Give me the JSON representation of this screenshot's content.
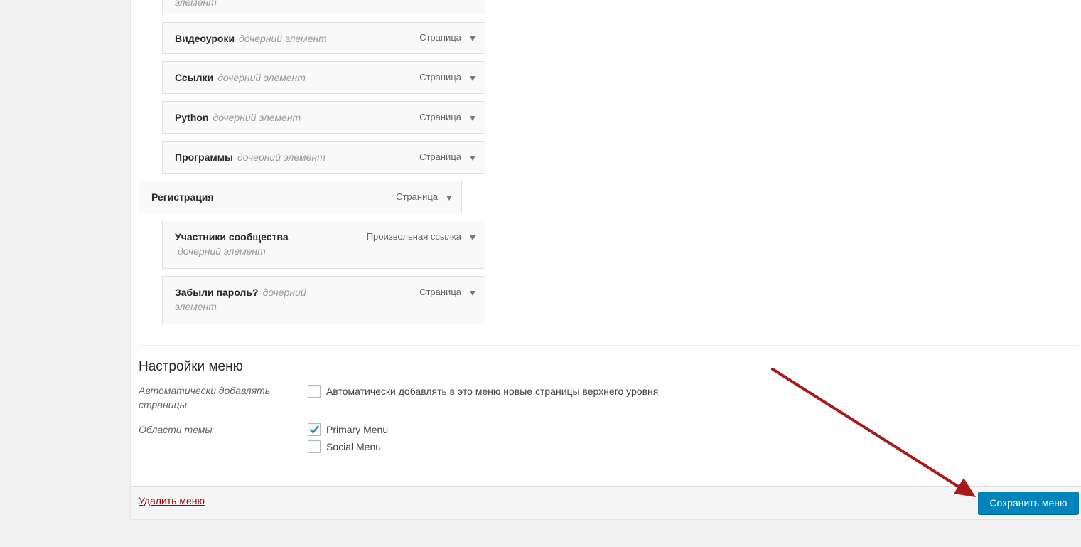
{
  "menu_structure": {
    "items": [
      {
        "title": "",
        "subtitle": "элемент",
        "type": "",
        "level": 1
      },
      {
        "title": "Видеоуроки",
        "subtitle": "дочерний элемент",
        "type": "Страница",
        "level": 1
      },
      {
        "title": "Ссылки",
        "subtitle": "дочерний элемент",
        "type": "Страница",
        "level": 1
      },
      {
        "title": "Python",
        "subtitle": "дочерний элемент",
        "type": "Страница",
        "level": 1
      },
      {
        "title": "Программы",
        "subtitle": "дочерний элемент",
        "type": "Страница",
        "level": 1
      },
      {
        "title": "Регистрация",
        "subtitle": "",
        "type": "Страница",
        "level": 0
      },
      {
        "title": "Участники сообщества",
        "subtitle": "дочерний элемент",
        "type": "Произвольная ссылка",
        "level": 1
      },
      {
        "title": "Забыли пароль?",
        "subtitle": "дочерний",
        "subtitle_line2": "элемент",
        "type": "Страница",
        "level": 1
      }
    ]
  },
  "menu_settings": {
    "title": "Настройки меню",
    "auto_add": {
      "label": "Автоматически добавлять страницы",
      "option": "Автоматически добавлять в это меню новые страницы верхнего уровня",
      "checked": false
    },
    "locations": {
      "label": "Области темы",
      "options": [
        {
          "label": "Primary Menu",
          "checked": true
        },
        {
          "label": "Social Menu",
          "checked": false
        }
      ]
    }
  },
  "footer": {
    "delete_label": "Удалить меню",
    "save_label": "Сохранить меню"
  },
  "colors": {
    "save_button": "#0085ba",
    "delete_link": "#aa0000",
    "annotation_arrow": "#a81a1a"
  }
}
